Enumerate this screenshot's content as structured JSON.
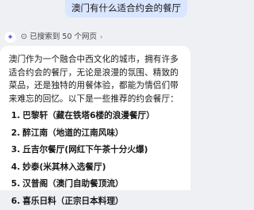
{
  "user_message": "澳门有什么适合约会的餐厅",
  "search": {
    "icon": "search-icon",
    "label": "已搜索到 50 个网页",
    "chevron": "chevron-right-icon"
  },
  "answer": {
    "intro": "澳门作为一个融合中西文化的城市，拥有许多适合约会的餐厅，无论是浪漫的氛围、精致的菜品，还是独特的用餐体验，都能为情侣们带来难忘的回忆。以下是一些推荐的约会餐厅：",
    "items": [
      {
        "num": "1.",
        "text": "巴黎轩（藏在铁塔6楼的浪漫餐厅）"
      },
      {
        "num": "2.",
        "text": "醉江南（地道的江南风味）"
      },
      {
        "num": "3.",
        "text": "丘吉尔餐厅(网红下午茶十分火爆)"
      },
      {
        "num": "4.",
        "text": "妙泰(米其林入选餐厅)"
      },
      {
        "num": "5.",
        "text": "汉普阁（澳门自助餐顶流）"
      },
      {
        "num": "6.",
        "text": "喜乐日料（正宗日本料理）"
      }
    ]
  }
}
